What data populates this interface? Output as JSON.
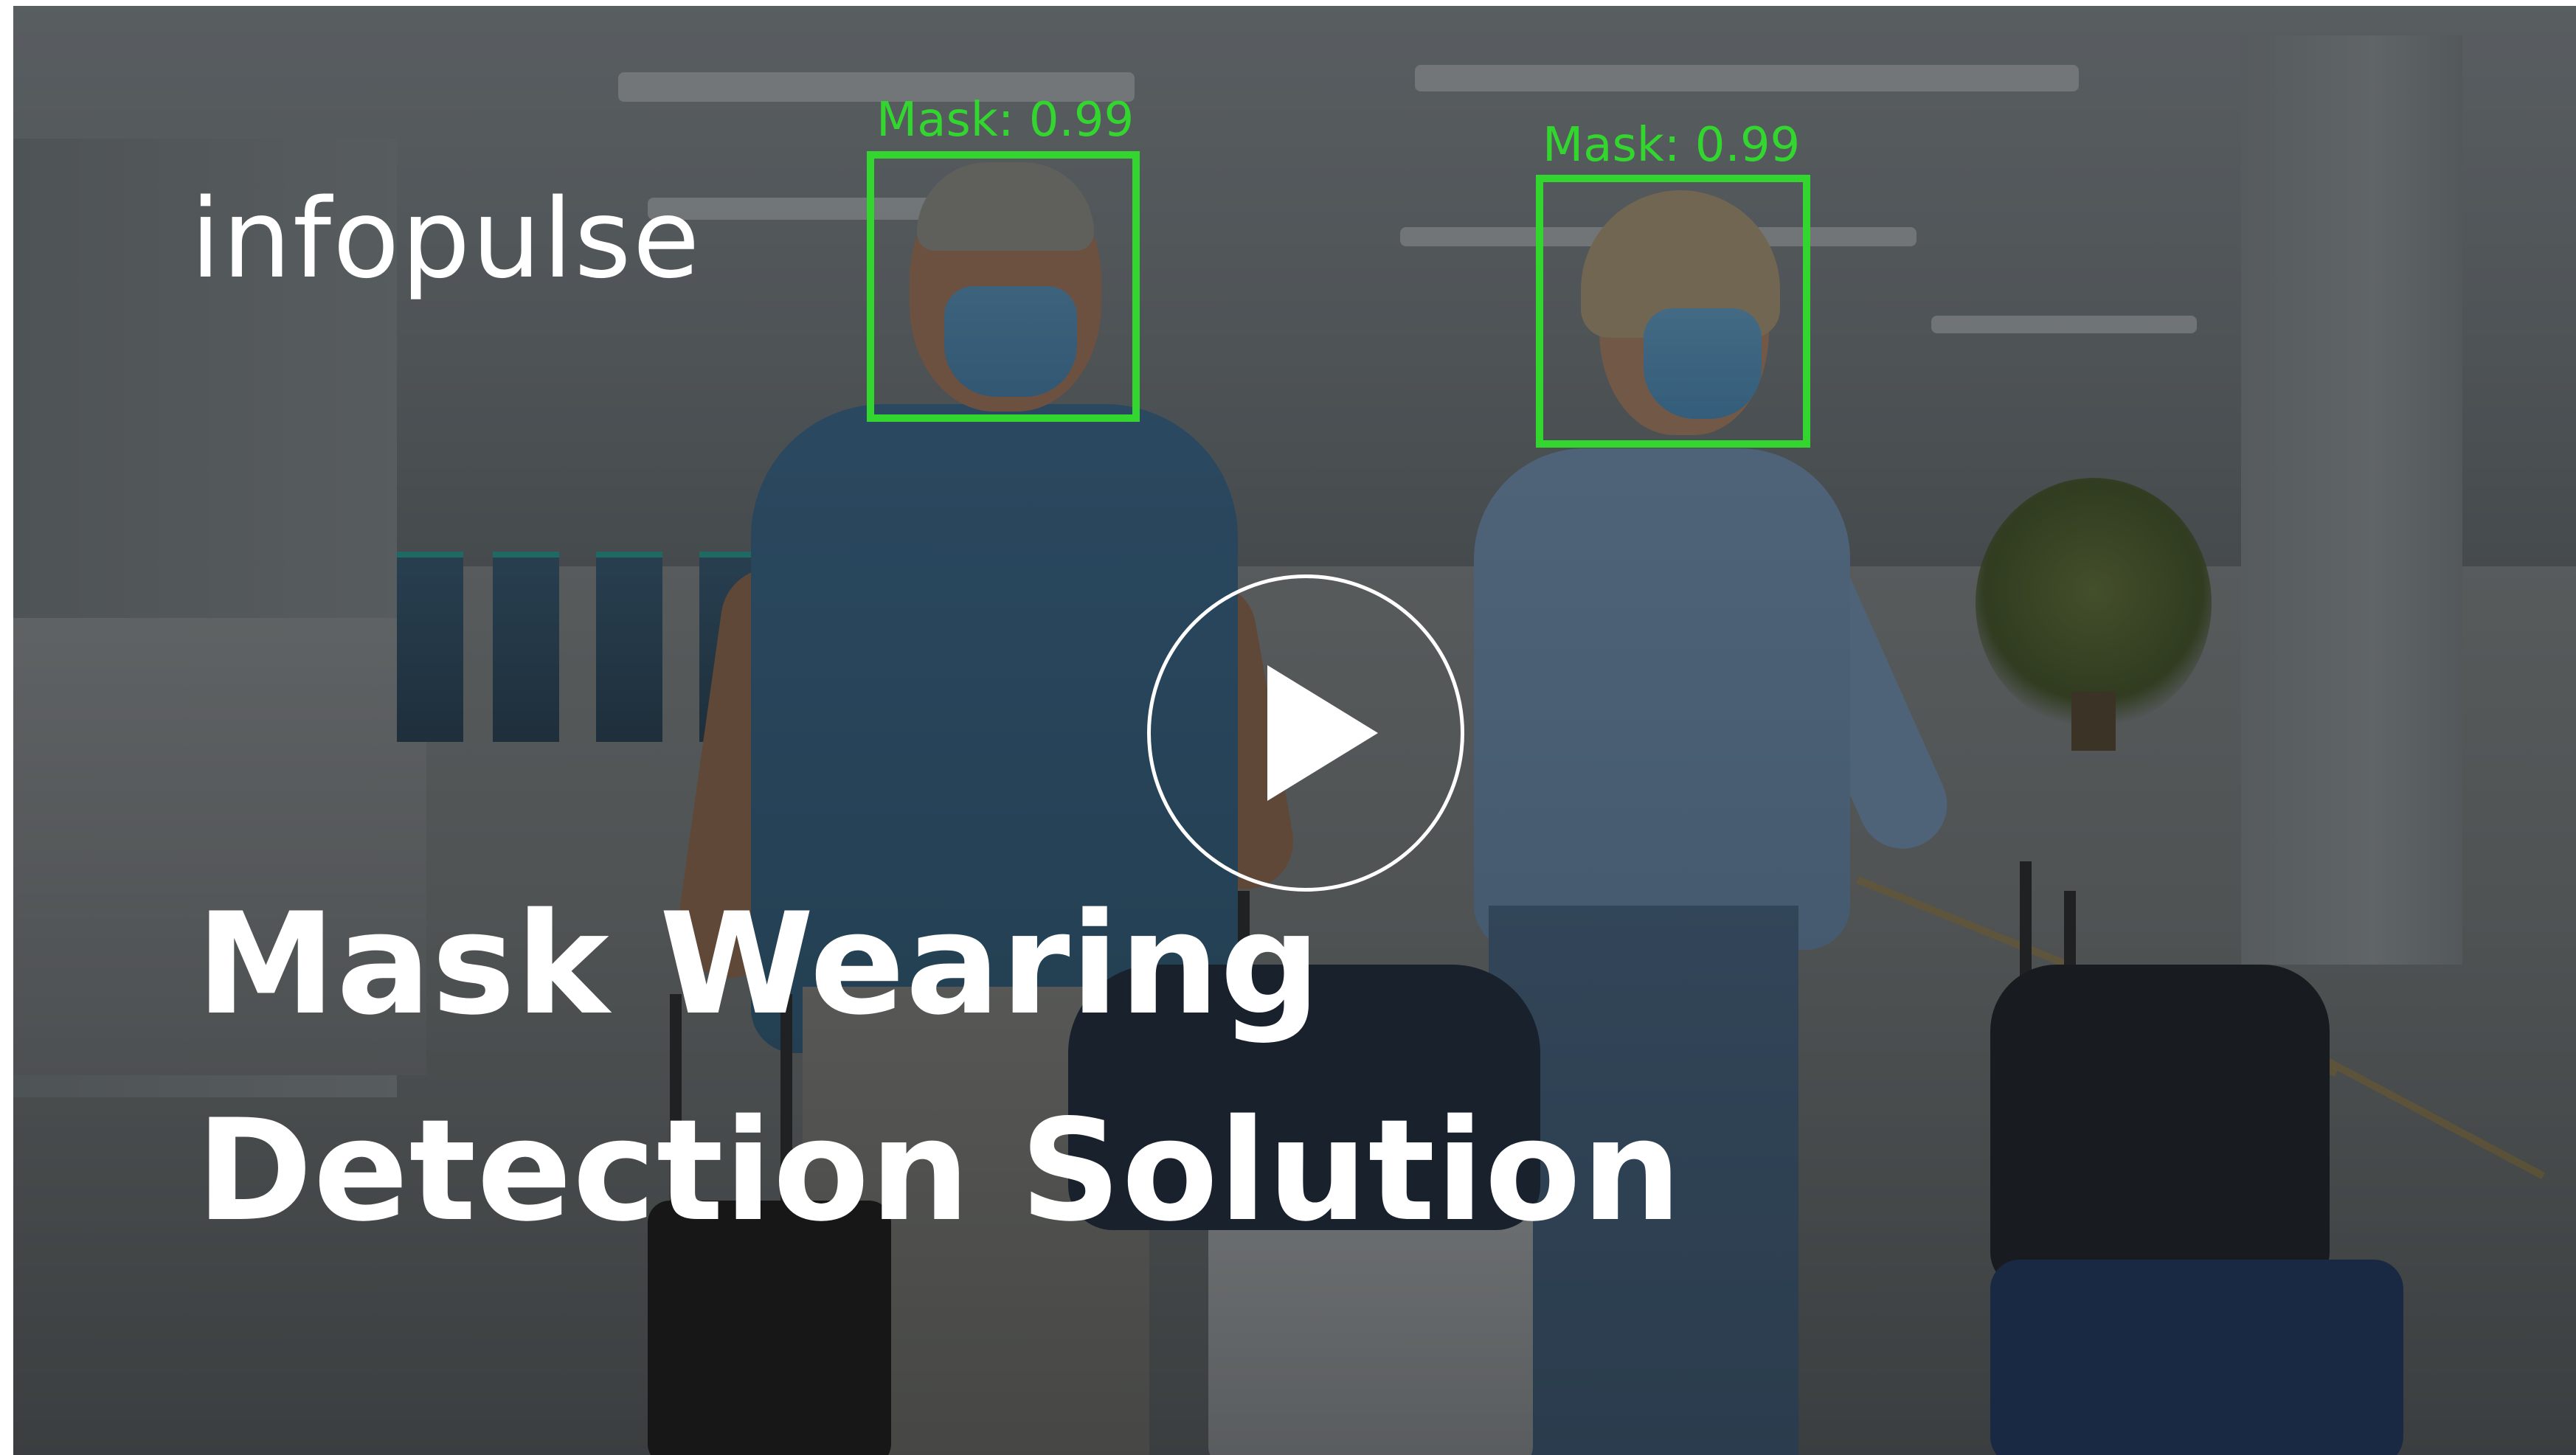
{
  "video": {
    "brand": "infopulse",
    "title_line1": "Mask Wearing",
    "title_line2": "Detection Solution",
    "play_icon": "play-icon"
  },
  "detections": [
    {
      "label": "Mask: 0.99"
    },
    {
      "label": "Mask: 0.99"
    }
  ],
  "colors": {
    "detection": "#33d62f",
    "text": "#ffffff"
  }
}
